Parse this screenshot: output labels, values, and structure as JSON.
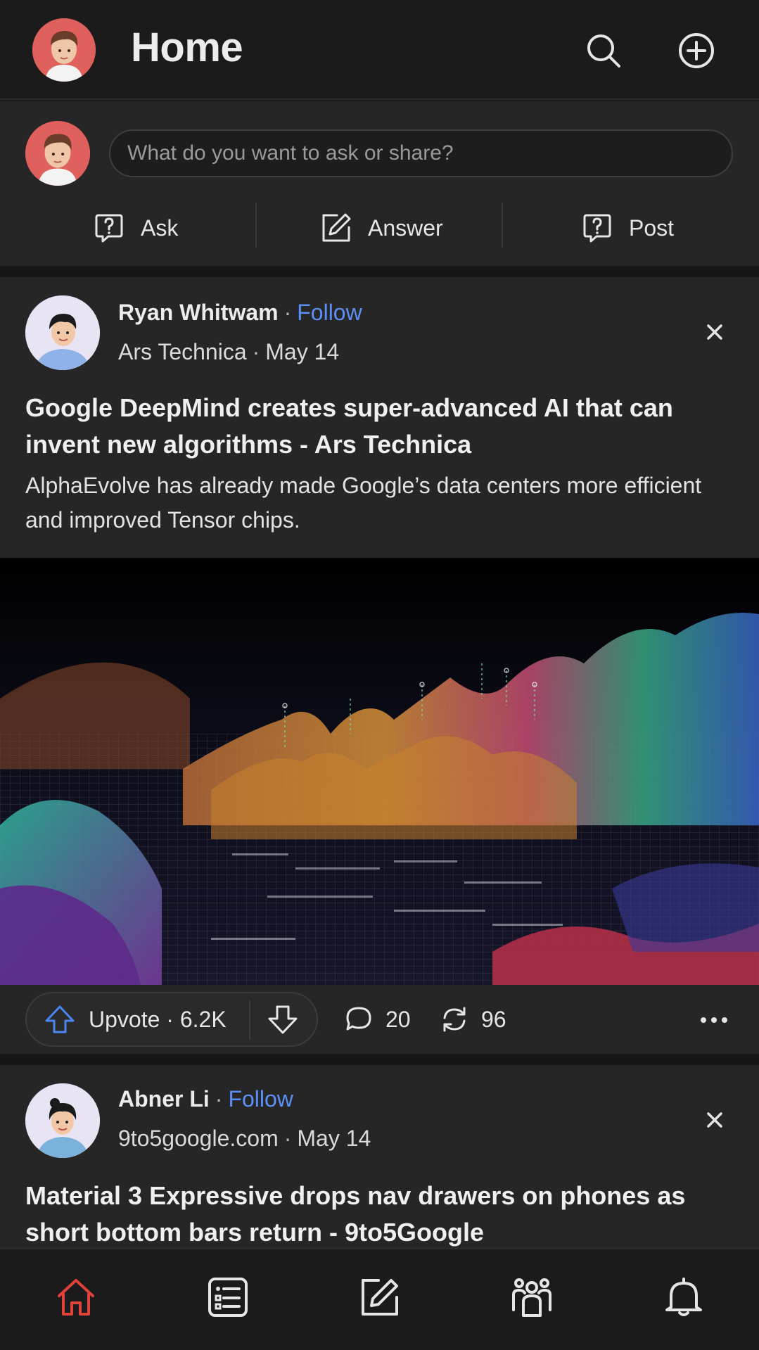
{
  "header": {
    "title": "Home",
    "avatar_icon": "user-avatar-icon",
    "search_icon": "search-icon",
    "add_icon": "plus-circle-icon"
  },
  "composer": {
    "placeholder": "What do you want to ask or share?",
    "actions": [
      {
        "label": "Ask",
        "icon": "question-icon"
      },
      {
        "label": "Answer",
        "icon": "pencil-icon"
      },
      {
        "label": "Post",
        "icon": "question-icon"
      }
    ]
  },
  "posts": [
    {
      "author": "Ryan Whitwam",
      "follow_label": "Follow",
      "source": "Ars Technica",
      "date": "May 14",
      "title": "Google DeepMind creates super-advanced AI that can invent new algorithms - Ars Technica",
      "excerpt": "AlphaEvolve has already made Google’s data centers more efficient and improved Tensor chips.",
      "upvote_label": "Upvote",
      "upvotes": "6.2K",
      "comments": "20",
      "reshares": "96"
    },
    {
      "author": "Abner Li",
      "follow_label": "Follow",
      "source": "9to5google.com",
      "date": "May 14",
      "title": "Material 3 Expressive drops nav drawers on phones as short bottom bars return - 9to5Google"
    }
  ],
  "bottom_nav": {
    "items": [
      "home-icon",
      "feed-icon",
      "write-icon",
      "spaces-icon",
      "bell-icon"
    ],
    "active": "home-icon"
  },
  "colors": {
    "background": "#181818",
    "card": "#262626",
    "follow": "#5c8ff7",
    "active_nav": "#e0413a",
    "upvote": "#4a86f0"
  }
}
